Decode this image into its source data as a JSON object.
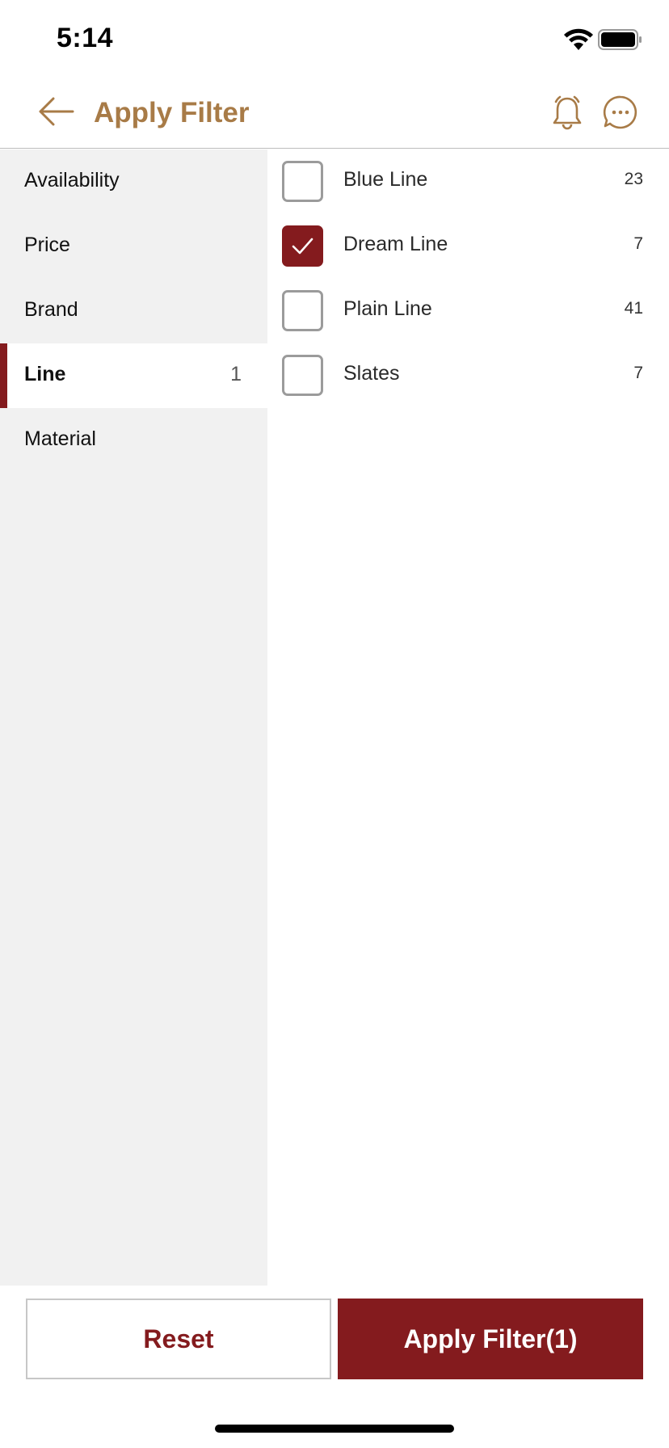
{
  "status_bar": {
    "time": "5:14"
  },
  "header": {
    "title": "Apply Filter"
  },
  "sidebar": {
    "items": [
      {
        "label": "Availability",
        "count": ""
      },
      {
        "label": "Price",
        "count": ""
      },
      {
        "label": "Brand",
        "count": ""
      },
      {
        "label": "Line",
        "count": "1"
      },
      {
        "label": "Material",
        "count": ""
      }
    ],
    "active": "Line"
  },
  "options": [
    {
      "label": "Blue Line",
      "count": "23",
      "checked": false
    },
    {
      "label": "Dream Line",
      "count": "7",
      "checked": true
    },
    {
      "label": "Plain Line",
      "count": "41",
      "checked": false
    },
    {
      "label": "Slates",
      "count": "7",
      "checked": false
    }
  ],
  "footer": {
    "reset_label": "Reset",
    "apply_label": "Apply Filter(1)"
  },
  "colors": {
    "accent": "#841b1e",
    "header_title": "#a87b47",
    "sidebar_bg": "#f1f1f1"
  }
}
